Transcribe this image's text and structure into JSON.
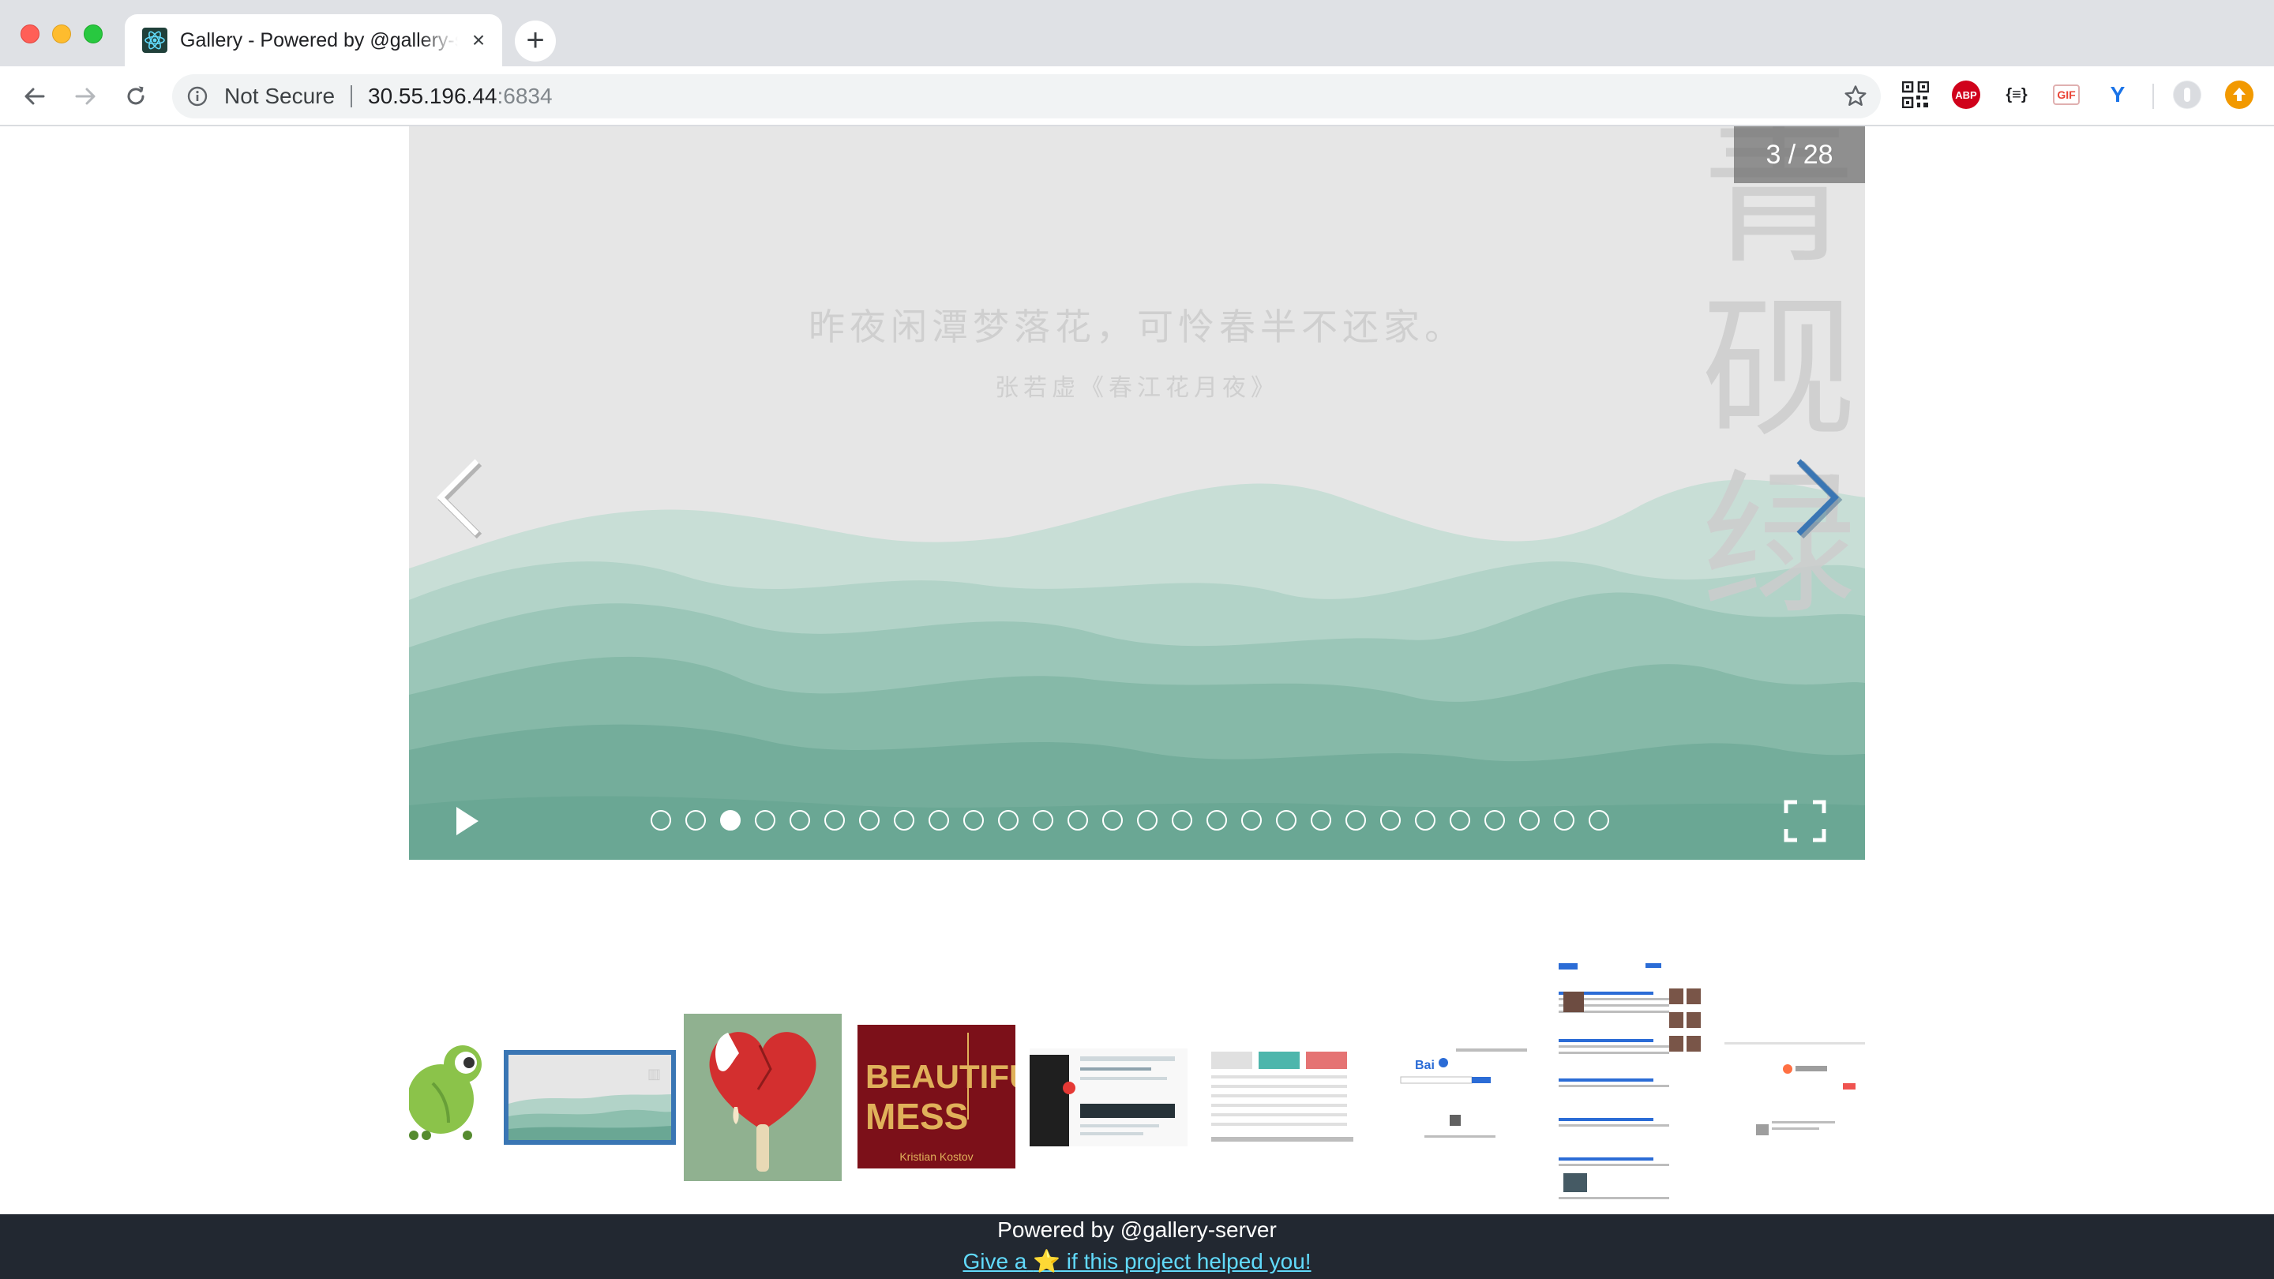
{
  "browser": {
    "tab_title": "Gallery - Powered by @gallery-server",
    "security_label": "Not Secure",
    "url_host": "30.55.196.44",
    "url_port": ":6834"
  },
  "extensions": {
    "abp_label": "ABP",
    "json_label": "{≡}",
    "gif_label": "GIF",
    "y_label": "Y"
  },
  "gallery": {
    "counter": "3 / 28",
    "total_slides": 28,
    "current_slide": 3,
    "slide": {
      "poem": "昨夜闲潭梦落花，可怜春半不还家。",
      "author": "张若虚《春江花月夜》",
      "vertical_title": [
        "青",
        "砚",
        "绿"
      ]
    }
  },
  "thumbnails": [
    {
      "name": "frog",
      "label": ""
    },
    {
      "name": "landscape",
      "label": ""
    },
    {
      "name": "heart-popsicle",
      "label": ""
    },
    {
      "name": "beautiful-mess",
      "title": "BEAUTIFUL MESS",
      "author": "Kristian Kostov"
    },
    {
      "name": "docs-page",
      "label": ""
    },
    {
      "name": "pricing-table",
      "label": ""
    },
    {
      "name": "baidu-home",
      "label": ""
    },
    {
      "name": "search-results",
      "label": ""
    },
    {
      "name": "sogou-search",
      "label": ""
    }
  ],
  "footer": {
    "powered_by": "Powered by @gallery-server",
    "link_prefix": "Give a",
    "link_star": "⭐",
    "link_suffix": " if this project helped you!"
  },
  "colors": {
    "accent_blue": "#3a76b4",
    "mountain_dark": "#6dab9a",
    "mountain_light": "#c9dfd7",
    "footer_bg": "#222831",
    "footer_link": "#61dafb"
  }
}
